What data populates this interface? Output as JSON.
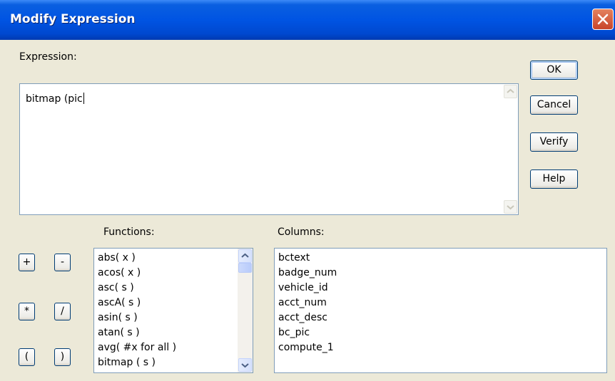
{
  "window": {
    "title": "Modify Expression"
  },
  "expression": {
    "label": "Expression:",
    "value": "bitmap (pic"
  },
  "buttons": {
    "ok": "OK",
    "cancel": "Cancel",
    "verify": "Verify",
    "help": "Help"
  },
  "operators": [
    "+",
    "-",
    "*",
    "/",
    "(",
    ")"
  ],
  "functions": {
    "label": "Functions:",
    "items": [
      "abs( x )",
      "acos( x )",
      "asc( s )",
      "ascA( s )",
      "asin( s )",
      "atan( s )",
      "avg( #x for all )",
      "bitmap ( s )"
    ]
  },
  "columns": {
    "label": "Columns:",
    "items": [
      "bctext",
      "badge_num",
      "vehicle_id",
      "acct_num",
      "acct_desc",
      "bc_pic",
      "compute_1"
    ]
  },
  "icons": {
    "close": "close-x-icon",
    "scroll_up": "arrow-up-icon",
    "scroll_down": "arrow-down-icon"
  },
  "colors": {
    "titlebar": "#0054e3",
    "dialog_bg": "#ece9d8",
    "close": "#c8442a"
  }
}
